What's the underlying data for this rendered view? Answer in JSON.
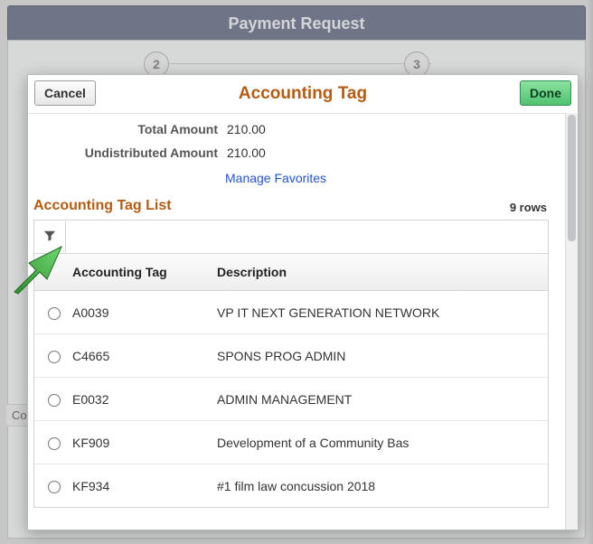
{
  "page": {
    "title": "Payment Request",
    "step2": "2",
    "step3": "3",
    "bg_label": "Cos"
  },
  "modal": {
    "title": "Accounting Tag",
    "cancel": "Cancel",
    "done": "Done",
    "total_label": "Total Amount",
    "total_value": "210.00",
    "undist_label": "Undistributed Amount",
    "undist_value": "210.00",
    "manage_favorites": "Manage Favorites",
    "list_title": "Accounting Tag List",
    "row_count": "9 rows",
    "col_tag": "Accounting Tag",
    "col_desc": "Description"
  },
  "rows": [
    {
      "tag": "A0039",
      "desc": "VP IT NEXT GENERATION NETWORK"
    },
    {
      "tag": "C4665",
      "desc": "SPONS PROG ADMIN"
    },
    {
      "tag": "E0032",
      "desc": "ADMIN MANAGEMENT"
    },
    {
      "tag": "KF909",
      "desc": "Development of a Community Bas"
    },
    {
      "tag": "KF934",
      "desc": "#1 film law concussion  2018"
    }
  ]
}
